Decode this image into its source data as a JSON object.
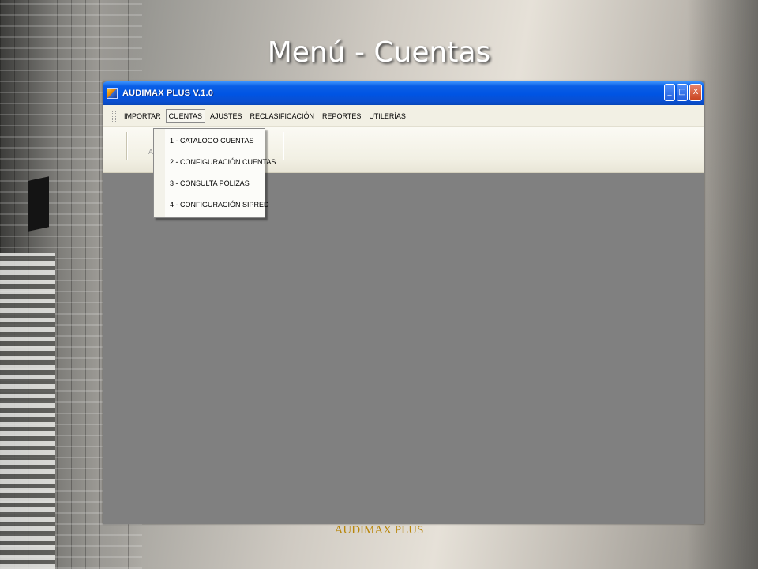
{
  "slide": {
    "title": "Menú - Cuentas",
    "footer": "AUDIMAX PLUS"
  },
  "window": {
    "title": "AUDIMAX PLUS V.1.0",
    "controls": {
      "minimize": "_",
      "maximize": "□",
      "close": "X"
    }
  },
  "menubar": {
    "items": [
      "IMPORTAR",
      "CUENTAS",
      "AJUSTES",
      "RECLASIFICACIÓN",
      "REPORTES",
      "UTILERÍAS"
    ],
    "active": "CUENTAS"
  },
  "toolbar": {
    "partial_label": "A"
  },
  "dropdown": {
    "items": [
      "1 - CATALOGO CUENTAS",
      "2 - CONFIGURACIÓN CUENTAS",
      "3 - CONSULTA POLIZAS",
      "4 - CONFIGURACIÓN SIPRED"
    ]
  },
  "colors": {
    "titlebar": "#0054e3",
    "client_area": "#808080",
    "footer_text": "#b8860b"
  }
}
